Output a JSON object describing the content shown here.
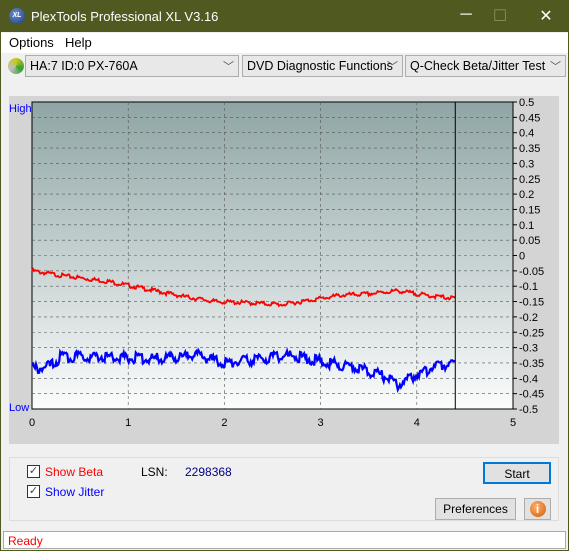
{
  "window": {
    "title": "PlexTools Professional XL V3.16",
    "logo": "XL",
    "minimize": "─",
    "maximize": "☐",
    "close": "✕"
  },
  "menu": [
    {
      "label": "Options"
    },
    {
      "label": "Help"
    }
  ],
  "toolbar": {
    "drive": "HA:7 ID:0  PX-760A",
    "function": "DVD Diagnostic Functions",
    "test": "Q-Check Beta/Jitter Test"
  },
  "chart_data": {
    "type": "line",
    "left_labels": {
      "high": "High",
      "low": "Low"
    },
    "xlim": [
      0,
      5
    ],
    "ylim": [
      -0.5,
      0.5
    ],
    "x_ticks": [
      "0",
      "1",
      "2",
      "3",
      "4",
      "5"
    ],
    "y_ticks": [
      "0.5",
      "0.45",
      "0.4",
      "0.35",
      "0.3",
      "0.25",
      "0.2",
      "0.15",
      "0.1",
      "0.05",
      "0",
      "-0.05",
      "-0.1",
      "-0.15",
      "-0.2",
      "-0.25",
      "-0.3",
      "-0.35",
      "-0.4",
      "-0.45",
      "-0.5"
    ],
    "grid": true,
    "marker_x": 4.4,
    "series": [
      {
        "name": "Beta",
        "color": "#ff0000",
        "x": [
          0,
          0.3,
          0.8,
          1.2,
          1.6,
          1.9,
          2.3,
          2.6,
          2.9,
          3.2,
          3.5,
          3.8,
          4.1,
          4.4
        ],
        "y": [
          -0.05,
          -0.065,
          -0.085,
          -0.11,
          -0.135,
          -0.15,
          -0.155,
          -0.16,
          -0.145,
          -0.13,
          -0.125,
          -0.115,
          -0.13,
          -0.14
        ]
      },
      {
        "name": "Jitter",
        "color": "#0000ff",
        "x": [
          0,
          0.2,
          0.3,
          0.8,
          1.2,
          1.5,
          1.7,
          1.9,
          2.0,
          2.3,
          2.7,
          3.0,
          3.3,
          3.6,
          3.8,
          4.0,
          4.2,
          4.4
        ],
        "y": [
          -0.37,
          -0.36,
          -0.33,
          -0.33,
          -0.335,
          -0.335,
          -0.32,
          -0.345,
          -0.35,
          -0.34,
          -0.325,
          -0.345,
          -0.36,
          -0.385,
          -0.42,
          -0.39,
          -0.36,
          -0.35
        ]
      }
    ]
  },
  "controls": {
    "show_beta": "Show Beta",
    "show_jitter": "Show Jitter",
    "lsn_label": "LSN:",
    "lsn_value": "2298368",
    "start": "Start",
    "preferences": "Preferences",
    "info": "i"
  },
  "status": "Ready"
}
